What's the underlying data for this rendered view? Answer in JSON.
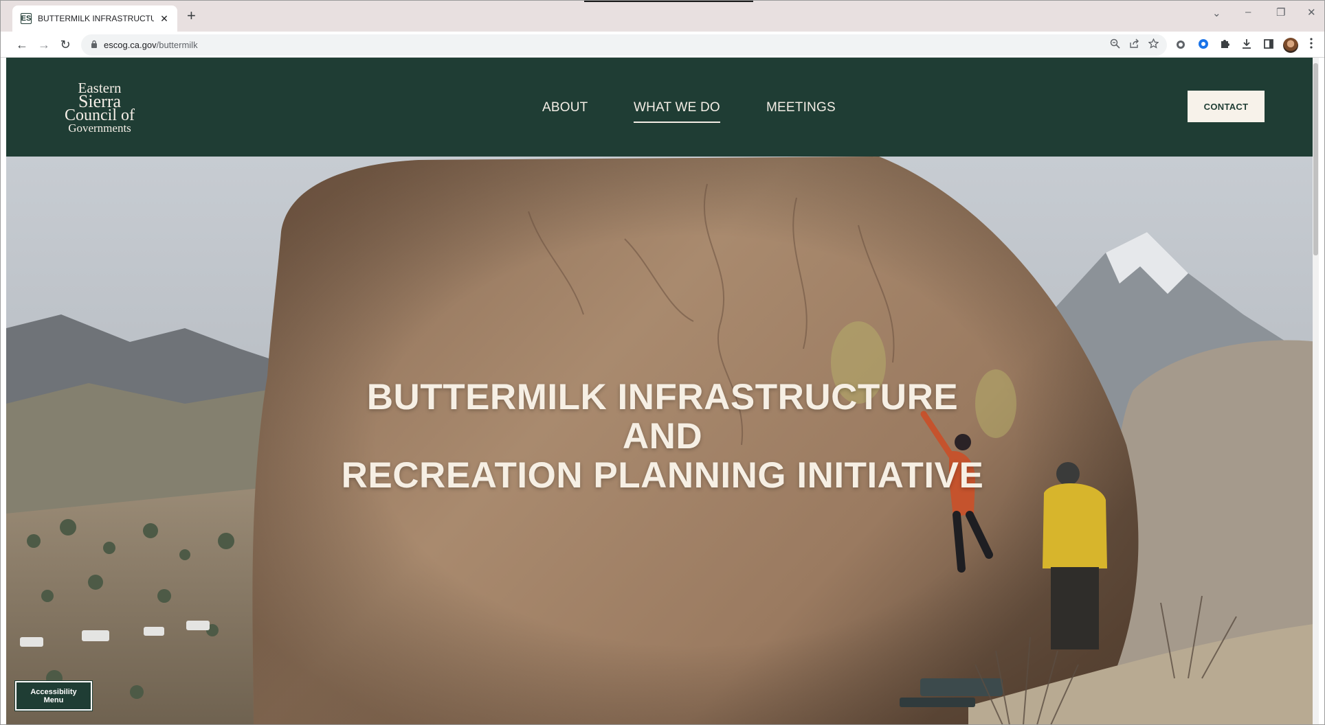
{
  "browser": {
    "tab": {
      "favicon": "ES",
      "title": "BUTTERMILK INFRASTRUCTURE A",
      "close_glyph": "✕"
    },
    "new_tab_glyph": "+",
    "window_controls": {
      "tab_search": "⌄",
      "minimize": "–",
      "restore": "❐",
      "close": "✕"
    },
    "nav": {
      "back": "←",
      "forward": "→",
      "reload": "↻"
    },
    "address": {
      "domain": "escog.ca.gov",
      "path": "/buttermilk"
    },
    "icons": {
      "lock": "lock-icon",
      "zoom": "zoom-icon",
      "share": "share-icon",
      "star": "bookmark-star-icon",
      "extensions": [
        "extension-icon",
        "chrome-extension-icon",
        "puzzle-icon",
        "download-icon",
        "side-panel-icon"
      ],
      "profile": "profile-avatar-icon",
      "menu": "kebab-menu-icon"
    }
  },
  "site": {
    "logo": {
      "line1": "Eastern",
      "line2": "Sierra",
      "line3": "Council of",
      "line4": "Governments"
    },
    "nav": [
      {
        "label": "ABOUT",
        "active": false
      },
      {
        "label": "WHAT WE DO",
        "active": true
      },
      {
        "label": "MEETINGS",
        "active": false
      }
    ],
    "contact_label": "CONTACT",
    "hero": {
      "line1": "BUTTERMILK INFRASTRUCTURE",
      "line2": "AND",
      "line3": "RECREATION PLANNING INITIATIVE"
    },
    "accessibility": {
      "line1": "Accessibility",
      "line2": "Menu"
    },
    "colors": {
      "brand_green": "#1f3d34",
      "cream": "#f7f2ea"
    }
  }
}
